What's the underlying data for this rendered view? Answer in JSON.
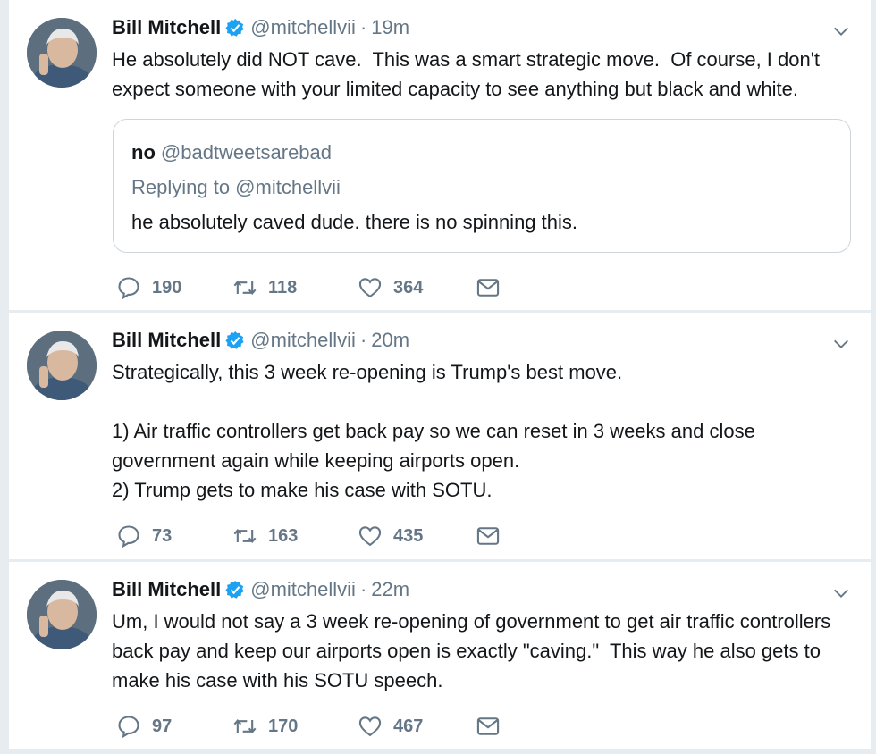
{
  "tweets": [
    {
      "name": "Bill Mitchell",
      "handle": "@mitchellvii",
      "separator": "·",
      "time": "19m",
      "text": "He absolutely did NOT cave.  This was a smart strategic move.  Of course, I don't expect someone with your limited capacity to see anything but black and white.",
      "quote": {
        "name": "no",
        "handle": "@badtweetsarebad",
        "replying": "Replying to @mitchellvii",
        "text": "he absolutely caved dude. there is no spinning this."
      },
      "replies": "190",
      "retweets": "118",
      "likes": "364"
    },
    {
      "name": "Bill Mitchell",
      "handle": "@mitchellvii",
      "separator": "·",
      "time": "20m",
      "text": "Strategically, this 3 week re-opening is Trump's best move.\n\n1) Air traffic controllers get back pay so we can reset in 3 weeks and close government again while keeping airports open.\n2) Trump gets to make his case with SOTU.",
      "replies": "73",
      "retweets": "163",
      "likes": "435"
    },
    {
      "name": "Bill Mitchell",
      "handle": "@mitchellvii",
      "separator": "·",
      "time": "22m",
      "text": "Um, I would not say a 3 week re-opening of government to get air traffic controllers back pay and keep our airports open is exactly \"caving.\"  This way he also gets to make his case with his SOTU speech.",
      "replies": "97",
      "retweets": "170",
      "likes": "467"
    }
  ],
  "icons": {
    "verified": "verified-badge-icon",
    "caret": "chevron-down-icon",
    "reply": "reply-icon",
    "retweet": "retweet-icon",
    "like": "heart-icon",
    "dm": "envelope-icon"
  },
  "colors": {
    "verified": "#1da1f2",
    "muted": "#657786",
    "text": "#14171a",
    "divider": "#e6ecf0"
  }
}
